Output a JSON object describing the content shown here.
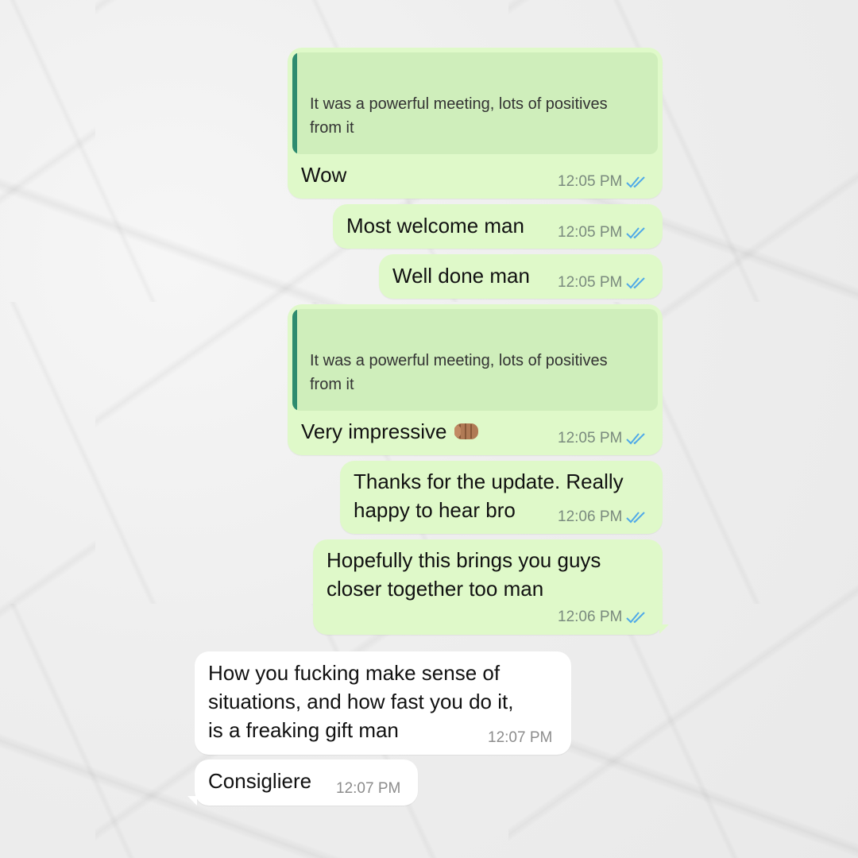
{
  "messages": [
    {
      "quote": "It was a powerful meeting, lots of positives\nfrom it",
      "text": "Wow",
      "time": "12:05 PM"
    },
    {
      "text": "Most welcome man",
      "time": "12:05 PM"
    },
    {
      "text": "Well done man",
      "time": "12:05 PM"
    },
    {
      "quote": "It was a powerful meeting, lots of positives\nfrom it",
      "text": "Very impressive ",
      "emoji": "oncoming-fist-medium-skin",
      "time": "12:05 PM"
    },
    {
      "text": "Thanks for the update. Really\nhappy to hear bro",
      "time": "12:06 PM"
    },
    {
      "text": "Hopefully this brings you guys\ncloser together too man",
      "time": "12:06 PM"
    },
    {
      "text": "How you fucking make sense of\nsituations, and how fast you do it,\nis a freaking gift man",
      "time": "12:07 PM"
    },
    {
      "text": "Consigliere",
      "time": "12:07 PM"
    }
  ],
  "colors": {
    "outgoing_bubble": "#dff9c9",
    "quote_background": "#cfeebb",
    "quote_bar": "#2e8b6f",
    "incoming_bubble": "#ffffff",
    "read_ticks": "#4fa9e8"
  },
  "icons": {
    "read_status": "double-check-icon"
  }
}
